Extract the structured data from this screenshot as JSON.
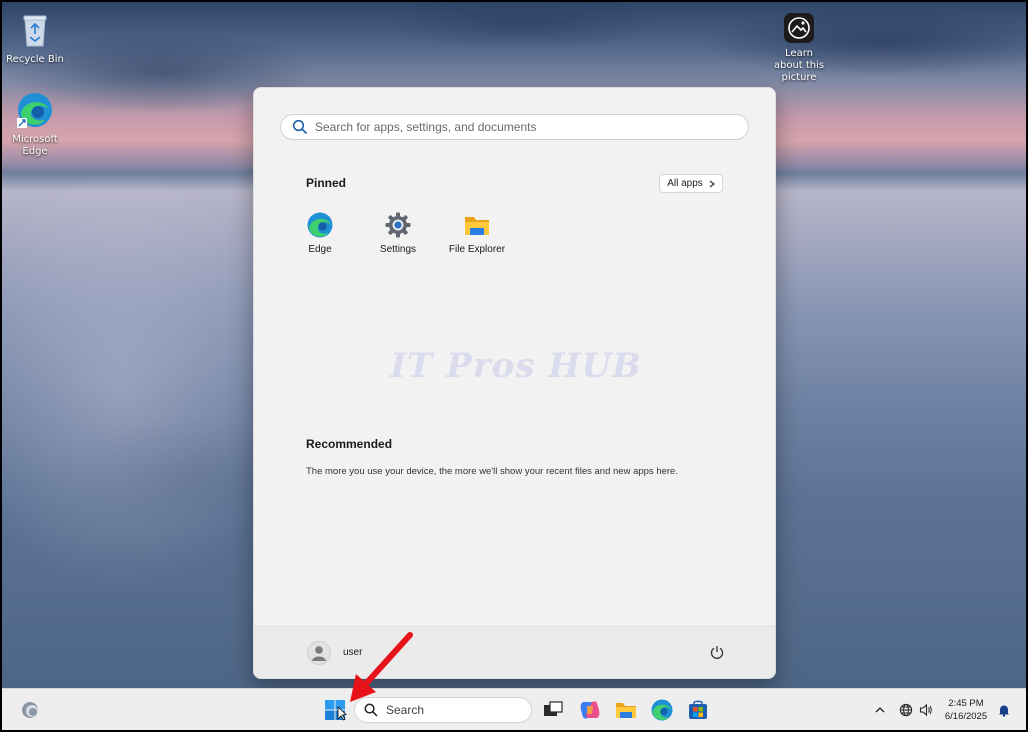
{
  "desktop": {
    "icons": [
      {
        "label": "Recycle Bin"
      },
      {
        "label": "Microsoft Edge"
      },
      {
        "label": "Learn about this picture"
      }
    ]
  },
  "start_menu": {
    "search_placeholder": "Search for apps, settings, and documents",
    "pinned_title": "Pinned",
    "all_apps_label": "All apps",
    "pinned_apps": [
      {
        "label": "Edge",
        "icon": "edge-icon"
      },
      {
        "label": "Settings",
        "icon": "gear-icon"
      },
      {
        "label": "File Explorer",
        "icon": "folder-icon"
      }
    ],
    "watermark": "IT Pros HUB",
    "recommended_title": "Recommended",
    "recommended_text": "The more you use your device, the more we'll show your recent files and new apps here.",
    "user_name": "user"
  },
  "taskbar": {
    "search_label": "Search",
    "time": "2:45 PM",
    "date": "6/16/2025"
  },
  "colors": {
    "accent_blue": "#0078d4",
    "annotation_red": "#e8121a"
  }
}
